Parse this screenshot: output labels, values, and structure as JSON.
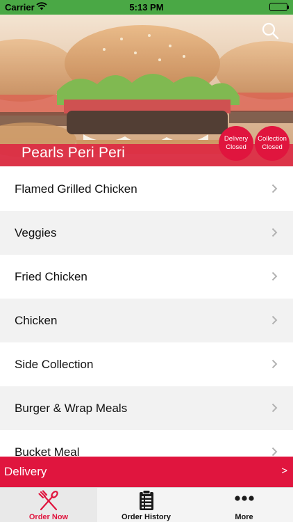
{
  "status_bar": {
    "carrier": "Carrier",
    "time": "5:13 PM",
    "icons": [
      "wifi-icon",
      "battery-icon"
    ]
  },
  "hero": {
    "store_name": "Pearls Peri Peri",
    "search_icon": "search-icon",
    "badges": {
      "delivery": {
        "line1": "Delivery",
        "line2": "Closed"
      },
      "collection": {
        "line1": "Collection",
        "line2": "Closed"
      }
    }
  },
  "menu": {
    "items": [
      {
        "label": "Flamed Grilled Chicken"
      },
      {
        "label": "Veggies"
      },
      {
        "label": "Fried Chicken"
      },
      {
        "label": "Chicken"
      },
      {
        "label": "Side Collection"
      },
      {
        "label": "Burger & Wrap Meals"
      },
      {
        "label": "Bucket Meal"
      }
    ]
  },
  "delivery_bar": {
    "label": "Delivery",
    "arrow": ">"
  },
  "tabs": {
    "order_now": "Order Now",
    "order_history": "Order History",
    "more": "More"
  },
  "colors": {
    "accent": "#e0153e",
    "status_bar": "#4aa845",
    "list_alt": "#f2f2f2"
  }
}
